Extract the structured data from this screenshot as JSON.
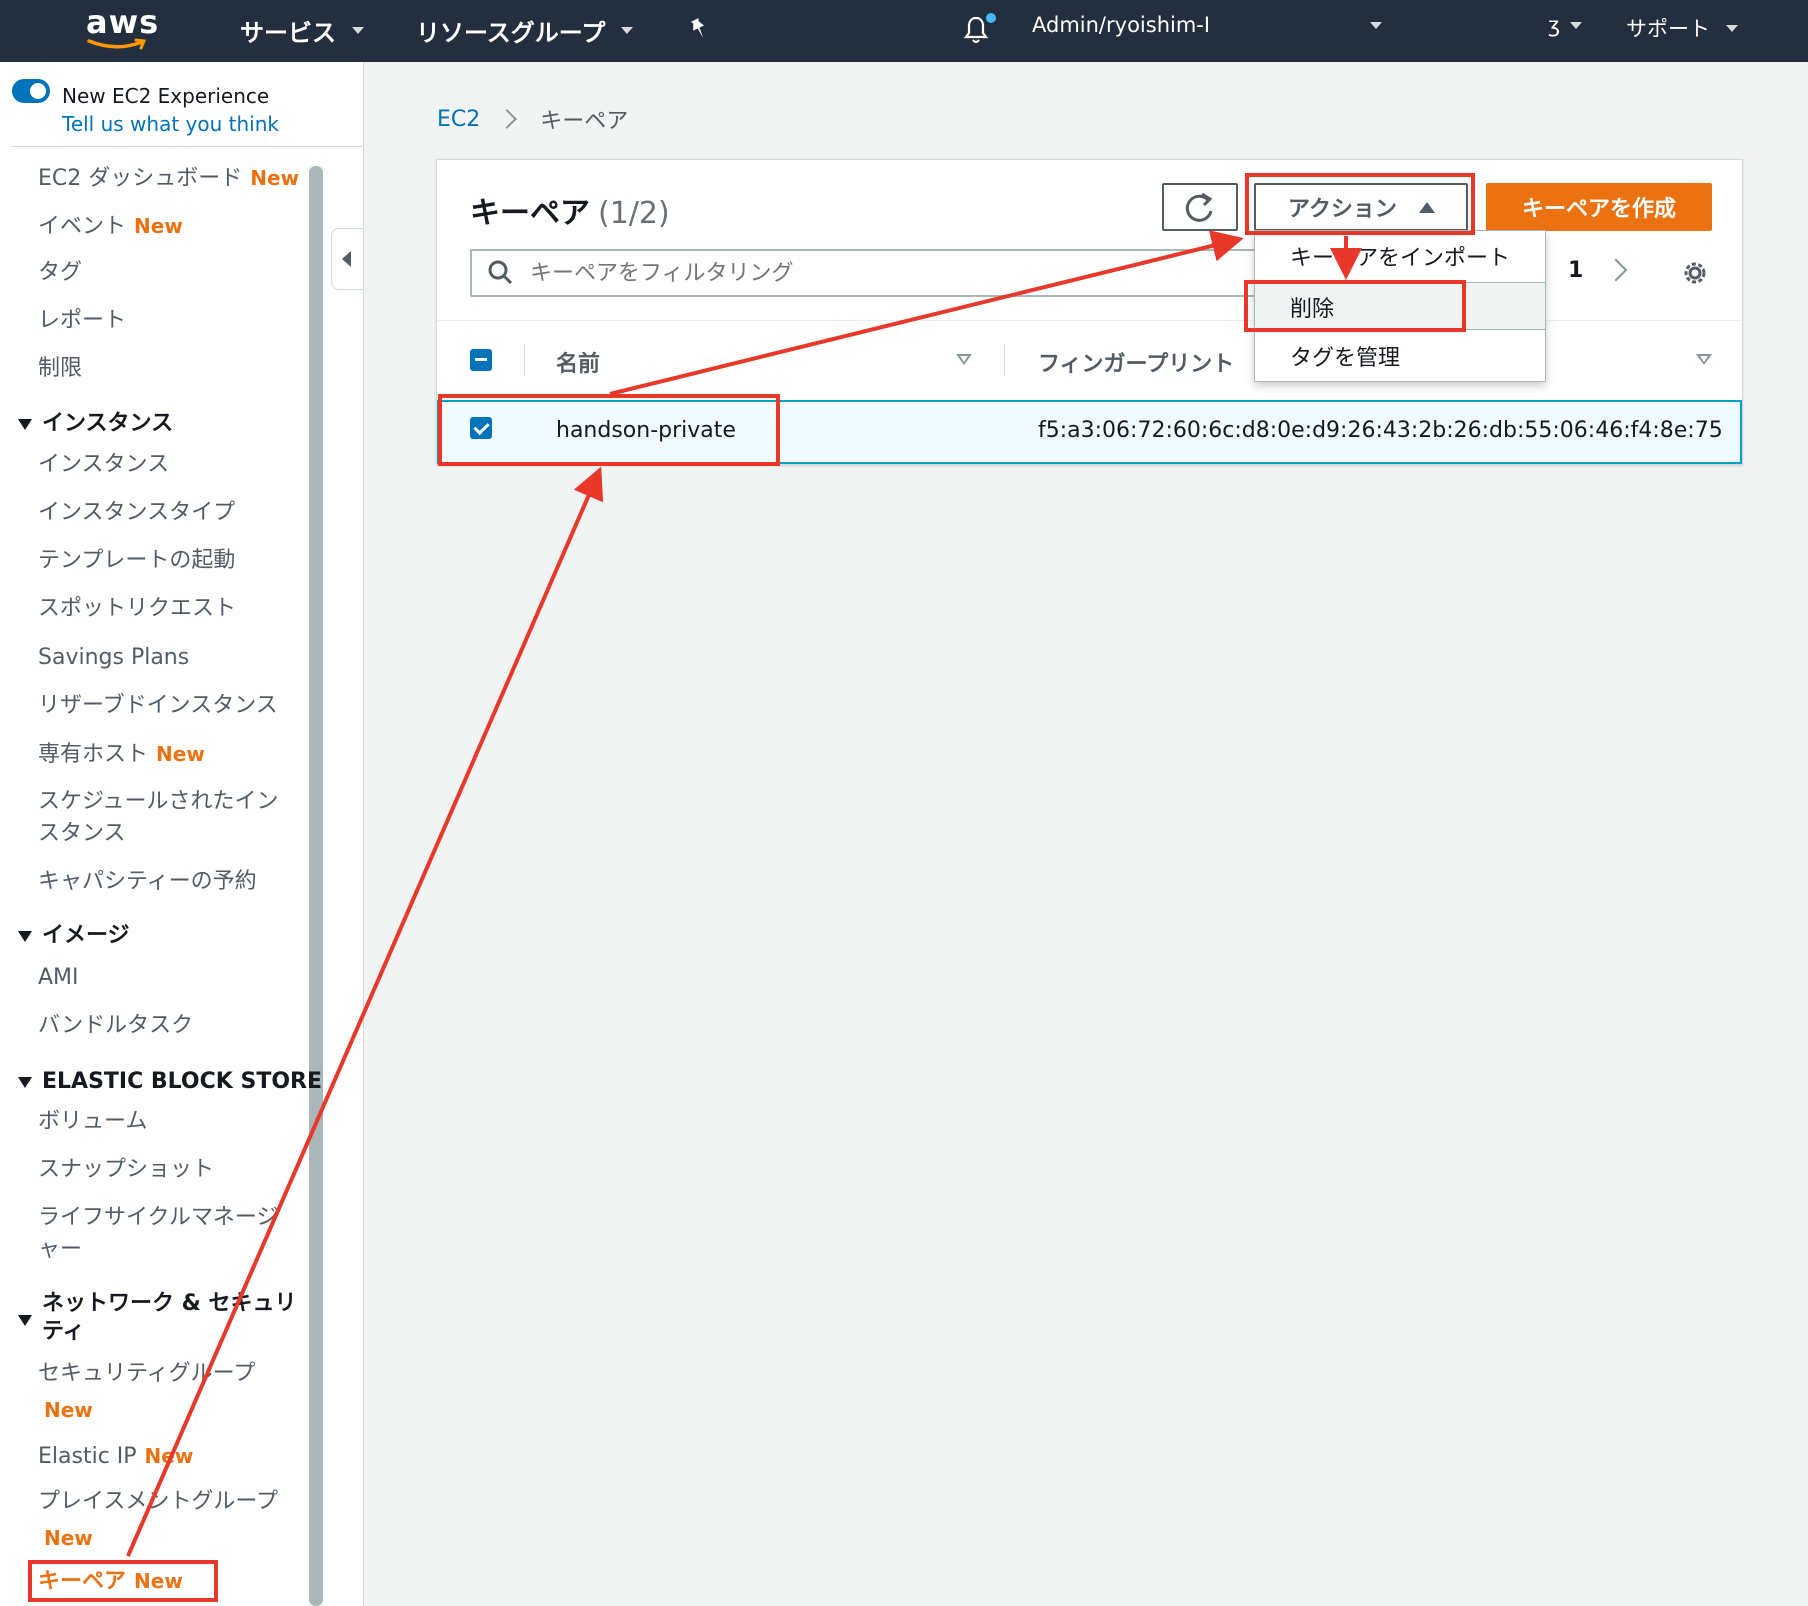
{
  "topnav": {
    "logo": "aws",
    "services": "サービス",
    "resource_groups": "リソースグループ",
    "account": "Admin/ryoishim-I",
    "region": "ʒ",
    "support": "サポート"
  },
  "leftnav": {
    "new_experience_title": "New EC2 Experience",
    "new_experience_link": "Tell us what you think",
    "new_badge": "New",
    "items": {
      "dashboard": "EC2 ダッシュボード",
      "events": "イベント",
      "tags": "タグ",
      "reports": "レポート",
      "limits": "制限"
    },
    "sections": {
      "instances": {
        "title": "インスタンス",
        "items": [
          "インスタンス",
          "インスタンスタイプ",
          "テンプレートの起動",
          "スポットリクエスト",
          "Savings Plans",
          "リザーブドインスタンス",
          "専有ホスト",
          "スケジュールされたイン",
          "スタンス",
          "キャパシティーの予約"
        ]
      },
      "images": {
        "title": "イメージ",
        "items": [
          "AMI",
          "バンドルタスク"
        ]
      },
      "ebs": {
        "title": "ELASTIC BLOCK STORE",
        "items": [
          "ボリューム",
          "スナップショット",
          "ライフサイクルマネージ",
          "ャー"
        ]
      },
      "network": {
        "title_line1": "ネットワーク & セキュリ",
        "title_line2": "ティ",
        "items": [
          "セキュリティグループ",
          "Elastic IP",
          "プレイスメントグループ",
          "キーペア"
        ]
      }
    }
  },
  "breadcrumb": {
    "root": "EC2",
    "current": "キーペア"
  },
  "panel": {
    "title": "キーペア",
    "count": "(1/2)",
    "actions_label": "アクション",
    "create_label": "キーペアを作成",
    "filter_placeholder": "キーペアをフィルタリング",
    "page": "1",
    "columns": [
      "名前",
      "フィンガープリント"
    ],
    "rows": [
      {
        "name": "handson-private",
        "fingerprint": "f5:a3:06:72:60:6c:d8:0e:d9:26:43:2b:26:db:55:06:46:f4:8e:75",
        "selected": true
      }
    ]
  },
  "actions_menu": {
    "items": [
      "キーペアをインポート",
      "削除",
      "タグを管理"
    ],
    "highlighted": "削除"
  },
  "colors": {
    "nav_bg": "#232f3e",
    "accent_orange": "#ec7211",
    "link_blue": "#0073bb",
    "annotation_red": "#e8382a"
  }
}
